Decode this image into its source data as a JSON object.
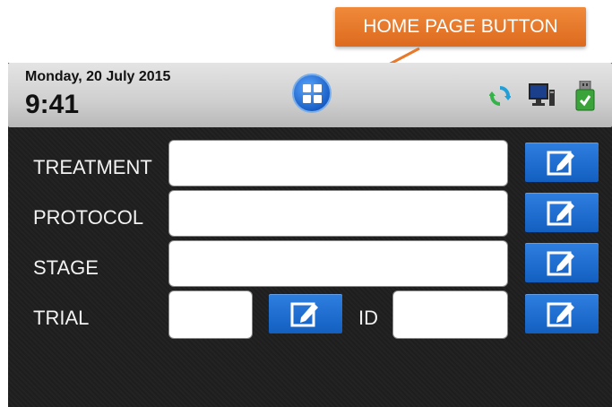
{
  "callout": {
    "text": "HOME PAGE BUTTON"
  },
  "header": {
    "date": "Monday, 20 July 2015",
    "time": "9:41"
  },
  "status_icons": [
    "refresh-icon",
    "network-computer-icon",
    "usb-drive-icon"
  ],
  "form": {
    "treatment_label": "TREATMENT",
    "protocol_label": "PROTOCOL",
    "stage_label": "STAGE",
    "trial_label": "TRIAL",
    "id_label": "ID",
    "treatment_value": "",
    "protocol_value": "",
    "stage_value": "",
    "trial_value": "",
    "id_value": ""
  },
  "colors": {
    "accent_blue": "#1a6ad6",
    "callout_orange": "#e8782a",
    "background": "#1e1e1e"
  }
}
